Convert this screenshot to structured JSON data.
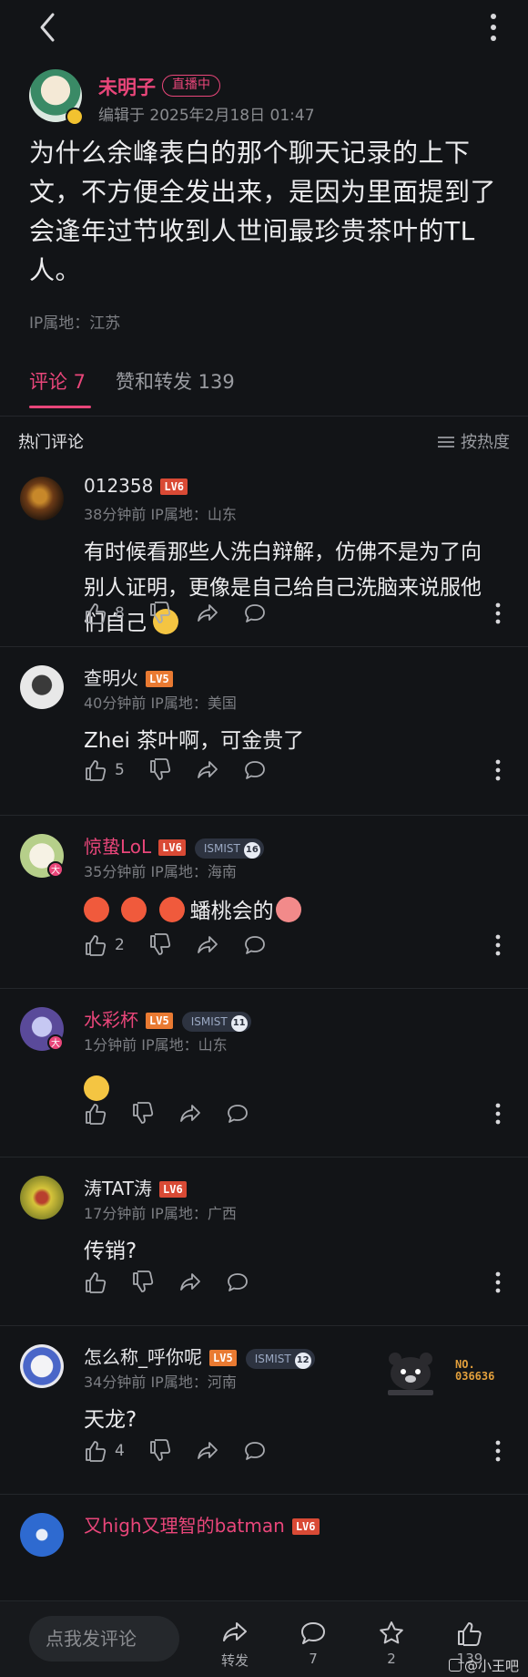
{
  "post": {
    "author": "未明子",
    "live_badge": "直播中",
    "edited": "编辑于 2025年2月18日 01:47",
    "content": "为什么余峰表白的那个聊天记录的上下文，不方便全发出来，是因为里面提到了会逢年过节收到人世间最珍贵茶叶的TL人。",
    "ip": "IP属地：江苏"
  },
  "tabs": {
    "comments": "评论 7",
    "likes_reposts": "赞和转发 139"
  },
  "hot": {
    "title": "热门评论",
    "sort_label": "按热度"
  },
  "comments": [
    {
      "name": "012358",
      "level": "LV6",
      "meta": "38分钟前 IP属地：山东",
      "text": "有时候看那些人洗白辩解，仿佛不是为了向别人证明，更像是自己给自己洗脑来说服他们自己",
      "likes": "8"
    },
    {
      "name": "查明火",
      "level": "LV5",
      "meta": "40分钟前 IP属地：美国",
      "text": "Zhei 茶叶啊，可金贵了",
      "likes": "5"
    },
    {
      "name": "惊蛰LoL",
      "level": "LV6",
      "badge": "ISMIST",
      "badge_num": "16",
      "avatar_badge": "大",
      "meta": "35分钟前 IP属地：海南",
      "text": "蟠桃会的",
      "likes": "2"
    },
    {
      "name": "水彩杯",
      "level": "LV5",
      "badge": "ISMIST",
      "badge_num": "11",
      "avatar_badge": "大",
      "meta": "1分钟前 IP属地：山东",
      "text": "",
      "likes": ""
    },
    {
      "name": "涛TAT涛",
      "level": "LV6",
      "meta": "17分钟前 IP属地：广西",
      "text": "传销?",
      "likes": ""
    },
    {
      "name": "怎么称_呼你呢",
      "level": "LV5",
      "badge": "ISMIST",
      "badge_num": "12",
      "meta": "34分钟前 IP属地：河南",
      "text": "天龙?",
      "likes": "4",
      "sticker_text": "NO.\n036636"
    },
    {
      "name": "又high又理智的batman",
      "level": "LV6"
    }
  ],
  "bottom": {
    "input_placeholder": "点我发评论",
    "repost_label": "转发",
    "comment_count": "7",
    "fav_count": "2",
    "like_count": "139",
    "watermark": "@小王吧"
  },
  "colors": {
    "accent": "#e9467a",
    "background": "#121417",
    "level6": "#d94a35",
    "level5": "#e97a32"
  },
  "icons": [
    "back-arrow-icon",
    "more-vertical-icon",
    "thumbs-up-icon",
    "thumbs-down-icon",
    "share-icon",
    "comment-bubble-icon",
    "star-icon",
    "sort-icon"
  ]
}
